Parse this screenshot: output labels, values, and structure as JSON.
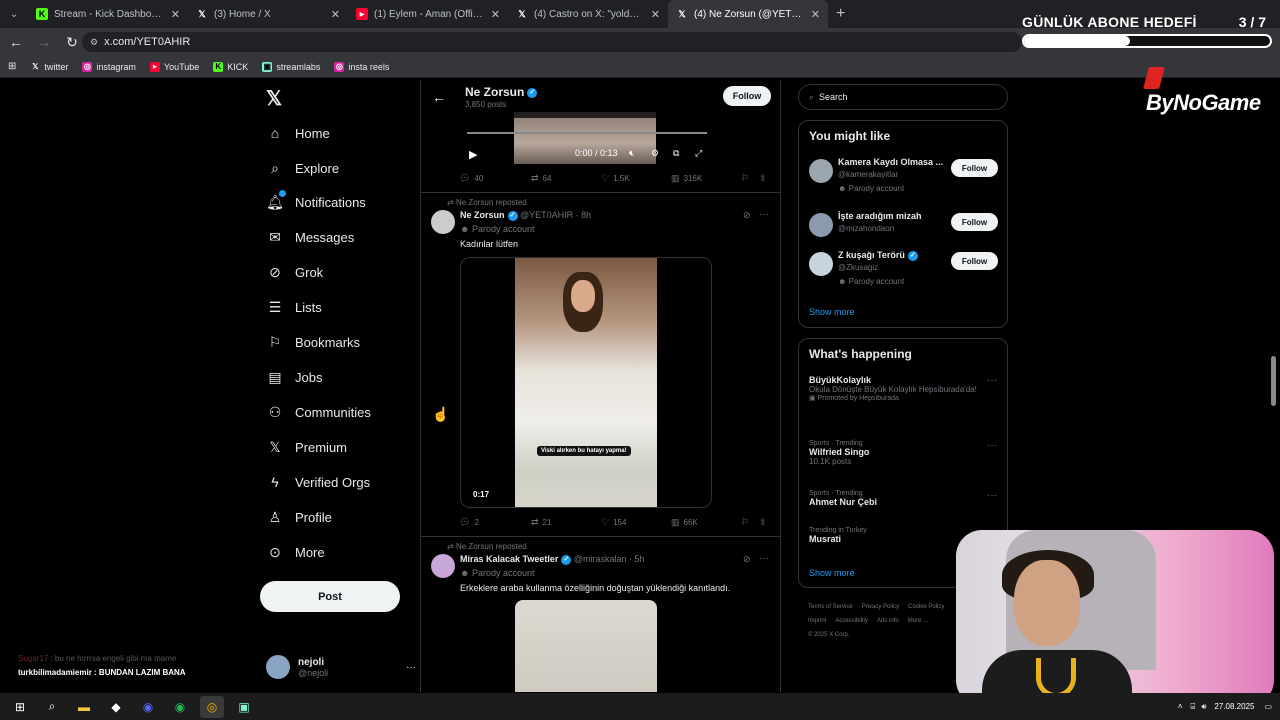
{
  "browser": {
    "tabs": [
      {
        "title": "Stream - Kick Dashboard",
        "icon": "kick-icon",
        "color": "#53fc18",
        "active": false
      },
      {
        "title": "(3) Home / X",
        "icon": "x-icon",
        "color": "#ffffff",
        "active": false
      },
      {
        "title": "(1) Eylem - Aman (Official Video)",
        "icon": "youtube-icon",
        "color": "#ff0033",
        "active": false
      },
      {
        "title": "(4) Castro on X: \"yolda yürürken",
        "icon": "x-icon",
        "color": "#ffffff",
        "active": false
      },
      {
        "title": "(4) Ne Zorsun (@YET0AHIR) / X",
        "icon": "x-icon",
        "color": "#ffffff",
        "active": true
      }
    ],
    "url": "x.com/YET0AHIR",
    "bookmarks": [
      "twitter",
      "instagram",
      "YouTube",
      "KICK",
      "streamlabs",
      "insta reels"
    ]
  },
  "overlay": {
    "goal_title": "GÜNLÜK ABONE HEDEFİ",
    "goal_count": "3 / 7",
    "goal_progress": 0.43,
    "brand": "ByNoGame"
  },
  "nav": {
    "items": [
      "Home",
      "Explore",
      "Notifications",
      "Messages",
      "Grok",
      "Lists",
      "Bookmarks",
      "Jobs",
      "Communities",
      "Premium",
      "Verified Orgs",
      "Profile",
      "More"
    ],
    "post_label": "Post",
    "account_name": "nejoli",
    "account_handle": "@nejoli"
  },
  "chat": [
    {
      "user": "Sugar17",
      "msg": "bu ne hırrrsa engeli gibi ma mame"
    },
    {
      "user": "turkbilimadamiemir",
      "msg": "BUNDAN LAZIM BANA"
    }
  ],
  "profile": {
    "name": "Ne Zorsun",
    "posts": "3,850 posts",
    "follow_label": "Follow"
  },
  "tweets": [
    {
      "video_time": "0:00 / 0:13",
      "replies": "40",
      "reposts": "64",
      "likes": "1.5K",
      "views": "316K"
    },
    {
      "reposted_by": "Ne Zorsun reposted",
      "name": "Ne Zorsun",
      "handle": "@YET0AHIR · 8h",
      "parody": "Parody account",
      "text": "Kadınlar lütfen",
      "caption": "Viski alırken bu hatayı yapma!",
      "duration": "0:17",
      "replies": "2",
      "reposts": "21",
      "likes": "154",
      "views": "66K"
    },
    {
      "reposted_by": "Ne Zorsun reposted",
      "name": "Miras Kalacak Tweetler",
      "handle": "@miraskalan · 5h",
      "parody": "Parody account",
      "text": "Erkeklere araba kullanma özelliğinin doğuştan yüklendiği kanıtlandı."
    }
  ],
  "sidebar": {
    "search_placeholder": "Search",
    "might_like_title": "You might like",
    "suggestions": [
      {
        "name": "Kamera Kaydı Olmasa ...",
        "handle": "@kamerakayitlar",
        "tag": "Parody account",
        "verified": false
      },
      {
        "name": "İşte aradığım mizah",
        "handle": "@mizahondaon",
        "tag": "Parody account",
        "verified": false
      },
      {
        "name": "Z kuşağı Terörü",
        "handle": "@Zkusagiz",
        "tag": "Parody account",
        "verified": true
      }
    ],
    "follow_label": "Follow",
    "show_more": "Show more",
    "happening_title": "What's happening",
    "trends": [
      {
        "category": "",
        "title": "BüyükKolaylık",
        "sub": "Okula Dönüşte Büyük Kolaylık Hepsiburada'da!",
        "meta": "Promoted by Hepsiburada"
      },
      {
        "category": "Sports · Trending",
        "title": "Wilfried Singo",
        "sub": "",
        "meta": "10.1K posts"
      },
      {
        "category": "Sports · Trending",
        "title": "Ahmet Nur Çebi",
        "sub": "",
        "meta": ""
      },
      {
        "category": "Trending in Turkey",
        "title": "Musrati",
        "sub": "",
        "meta": ""
      }
    ],
    "footer": [
      "Terms of Service",
      "Privacy Policy",
      "Cookie Policy",
      "Imprint",
      "Accessibility",
      "Ads info",
      "More ...",
      "© 2025 X Corp."
    ]
  },
  "taskbar": {
    "date": "27.08.2025"
  }
}
